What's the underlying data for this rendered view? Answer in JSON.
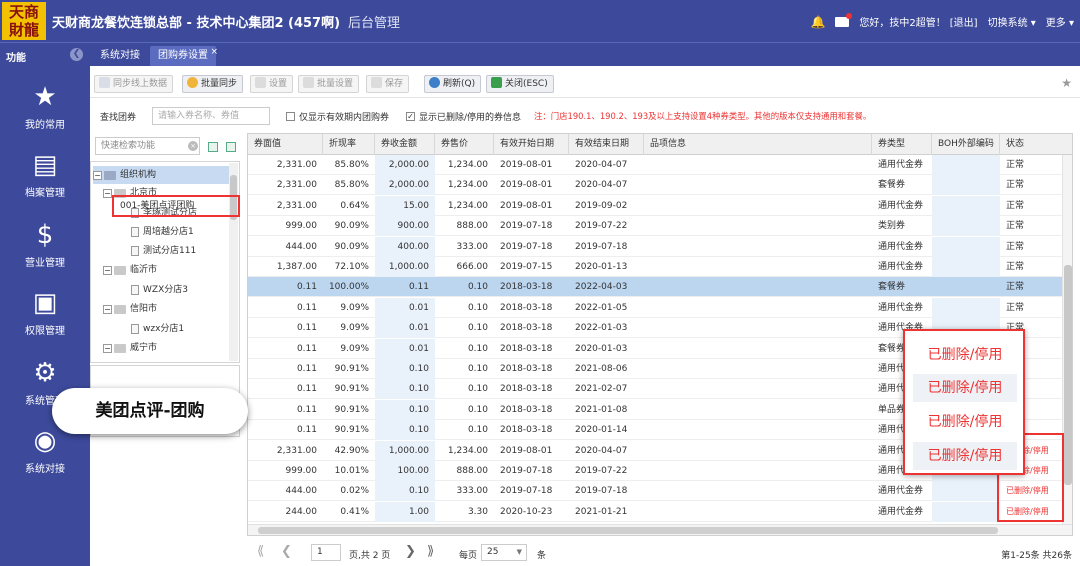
{
  "header": {
    "logo_top": "天商",
    "logo_bottom": "財龍",
    "title": "天财商龙餐饮连锁总部 - 技术中心集团2 (457啊)",
    "subtitle": "后台管理",
    "greeting": "您好，技中2超管！",
    "logout": "[退出]",
    "switch_system": "切换系统",
    "more": "更多"
  },
  "tabbar": {
    "function_label": "功能",
    "tabs": [
      {
        "label": "系统对接",
        "active": false
      },
      {
        "label": "团购券设置",
        "active": true
      }
    ],
    "close_symbol": "×"
  },
  "nav": [
    {
      "label": "我的常用",
      "icon": "star-icon"
    },
    {
      "label": "档案管理",
      "icon": "archive-icon"
    },
    {
      "label": "营业管理",
      "icon": "money-bag-icon"
    },
    {
      "label": "权限管理",
      "icon": "lock-icon"
    },
    {
      "label": "系统管理",
      "icon": "gears-icon"
    },
    {
      "label": "系统对接",
      "icon": "broadcast-icon"
    }
  ],
  "toolbar": {
    "sync_online": "同步线上数据",
    "batch_sync": "批量同步",
    "settings": "设置",
    "batch_settings": "批量设置",
    "save": "保存",
    "refresh": "刷新(Q)",
    "close": "关闭(ESC)"
  },
  "search": {
    "label": "查找团券",
    "placeholder": "请输入券名称、券值",
    "cb_valid_only": "仅显示有效期内团购券",
    "cb_show_deleted": "显示已删除/停用的券信息",
    "note": "注：门店190.1、190.2、193及以上支持设置4种券类型。其他的版本仅支持通用和套餐。"
  },
  "tree": {
    "search_placeholder": "快速检索功能",
    "nodes": [
      {
        "label": "组织机构",
        "level": 0,
        "type": "root",
        "selected": true
      },
      {
        "label": "北京市",
        "level": 1,
        "type": "folder"
      },
      {
        "label": "李琢测试分店",
        "level": 2,
        "type": "leaf"
      },
      {
        "label": "周培越分店1",
        "level": 2,
        "type": "leaf"
      },
      {
        "label": "测试分店111",
        "level": 2,
        "type": "leaf"
      },
      {
        "label": "临沂市",
        "level": 1,
        "type": "folder"
      },
      {
        "label": "WZX分店3",
        "level": 2,
        "type": "leaf"
      },
      {
        "label": "信阳市",
        "level": 1,
        "type": "folder"
      },
      {
        "label": "wzx分店1",
        "level": 2,
        "type": "leaf"
      },
      {
        "label": "威宁市",
        "level": 1,
        "type": "folder"
      }
    ],
    "meituan_item": "001-美团点评团购"
  },
  "grid": {
    "columns": [
      "券面值",
      "折现率",
      "券收金额",
      "券售价",
      "有效开始日期",
      "有效结束日期",
      "品项信息",
      "券类型",
      "BOH外部编码",
      "状态"
    ],
    "rows": [
      {
        "face": "2,331.00",
        "rate": "85.80%",
        "income": "2,000.00",
        "price": "1,234.00",
        "start": "2019-08-01",
        "end": "2020-04-07",
        "type": "通用代金券",
        "status": "正常"
      },
      {
        "face": "2,331.00",
        "rate": "85.80%",
        "income": "2,000.00",
        "price": "1,234.00",
        "start": "2019-08-01",
        "end": "2020-04-07",
        "type": "套餐券",
        "status": "正常"
      },
      {
        "face": "2,331.00",
        "rate": "0.64%",
        "income": "15.00",
        "price": "1,234.00",
        "start": "2019-08-01",
        "end": "2019-09-02",
        "type": "通用代金券",
        "status": "正常"
      },
      {
        "face": "999.00",
        "rate": "90.09%",
        "income": "900.00",
        "price": "888.00",
        "start": "2019-07-18",
        "end": "2019-07-22",
        "type": "类别券",
        "status": "正常"
      },
      {
        "face": "444.00",
        "rate": "90.09%",
        "income": "400.00",
        "price": "333.00",
        "start": "2019-07-18",
        "end": "2019-07-18",
        "type": "通用代金券",
        "status": "正常"
      },
      {
        "face": "1,387.00",
        "rate": "72.10%",
        "income": "1,000.00",
        "price": "666.00",
        "start": "2019-07-15",
        "end": "2020-01-13",
        "type": "通用代金券",
        "status": "正常"
      },
      {
        "face": "0.11",
        "rate": "100.00%",
        "income": "0.11",
        "price": "0.10",
        "start": "2018-03-18",
        "end": "2022-04-03",
        "type": "套餐券",
        "status": "正常",
        "highlight": true
      },
      {
        "face": "0.11",
        "rate": "9.09%",
        "income": "0.01",
        "price": "0.10",
        "start": "2018-03-18",
        "end": "2022-01-05",
        "type": "通用代金券",
        "status": "正常"
      },
      {
        "face": "0.11",
        "rate": "9.09%",
        "income": "0.01",
        "price": "0.10",
        "start": "2018-03-18",
        "end": "2022-01-03",
        "type": "通用代金券",
        "status": "正常"
      },
      {
        "face": "0.11",
        "rate": "9.09%",
        "income": "0.01",
        "price": "0.10",
        "start": "2018-03-18",
        "end": "2020-01-03",
        "type": "套餐券",
        "status": ""
      },
      {
        "face": "0.11",
        "rate": "90.91%",
        "income": "0.10",
        "price": "0.10",
        "start": "2018-03-18",
        "end": "2021-08-06",
        "type": "通用代",
        "status": ""
      },
      {
        "face": "0.11",
        "rate": "90.91%",
        "income": "0.10",
        "price": "0.10",
        "start": "2018-03-18",
        "end": "2021-02-07",
        "type": "通用代",
        "status": ""
      },
      {
        "face": "0.11",
        "rate": "90.91%",
        "income": "0.10",
        "price": "0.10",
        "start": "2018-03-18",
        "end": "2021-01-08",
        "type": "单品券",
        "status": ""
      },
      {
        "face": "0.11",
        "rate": "90.91%",
        "income": "0.10",
        "price": "0.10",
        "start": "2018-03-18",
        "end": "2020-01-14",
        "type": "通用代",
        "status": ""
      },
      {
        "face": "2,331.00",
        "rate": "42.90%",
        "income": "1,000.00",
        "price": "1,234.00",
        "start": "2019-08-01",
        "end": "2020-04-07",
        "type": "通用代",
        "status": "已删除/停用"
      },
      {
        "face": "999.00",
        "rate": "10.01%",
        "income": "100.00",
        "price": "888.00",
        "start": "2019-07-18",
        "end": "2019-07-22",
        "type": "通用代金券",
        "status": "已删除/停用"
      },
      {
        "face": "444.00",
        "rate": "0.02%",
        "income": "0.10",
        "price": "333.00",
        "start": "2019-07-18",
        "end": "2019-07-18",
        "type": "通用代金券",
        "status": "已删除/停用"
      },
      {
        "face": "244.00",
        "rate": "0.41%",
        "income": "1.00",
        "price": "3.30",
        "start": "2020-10-23",
        "end": "2021-01-21",
        "type": "通用代金券",
        "status": "已删除/停用"
      }
    ]
  },
  "popup": {
    "items": [
      "已删除/停用",
      "已删除/停用",
      "已删除/停用",
      "已删除/停用"
    ]
  },
  "callout": "美团点评-团购",
  "pager": {
    "page": "1",
    "of_pages": "页,共 2 页",
    "per_page_label": "每页",
    "per_page": "25",
    "unit": "条",
    "summary": "第1-25条 共26条"
  }
}
